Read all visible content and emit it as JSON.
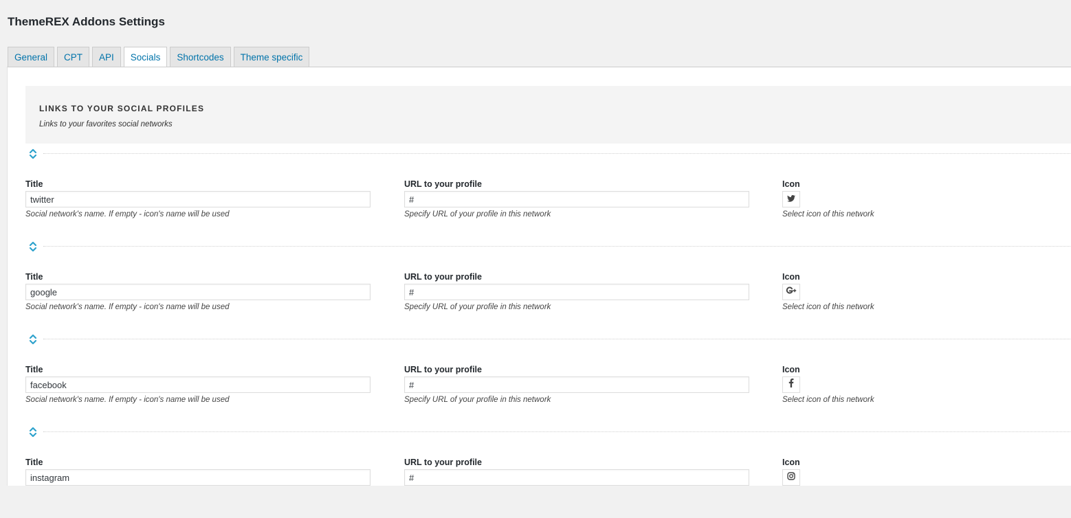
{
  "page": {
    "title": "ThemeREX Addons Settings"
  },
  "tabs": [
    {
      "label": "General",
      "active": false
    },
    {
      "label": "CPT",
      "active": false
    },
    {
      "label": "API",
      "active": false
    },
    {
      "label": "Socials",
      "active": true
    },
    {
      "label": "Shortcodes",
      "active": false
    },
    {
      "label": "Theme specific",
      "active": false
    }
  ],
  "section": {
    "title": "LINKS TO YOUR SOCIAL PROFILES",
    "subtitle": "Links to your favorites social networks"
  },
  "labels": {
    "title": "Title",
    "url": "URL to your profile",
    "icon": "Icon",
    "title_desc": "Social network's name. If empty - icon's name will be used",
    "url_desc": "Specify URL of your profile in this network",
    "icon_desc": "Select icon of this network"
  },
  "socials": [
    {
      "title": "twitter",
      "url": "#",
      "icon": "twitter-icon"
    },
    {
      "title": "google",
      "url": "#",
      "icon": "google-plus-icon"
    },
    {
      "title": "facebook",
      "url": "#",
      "icon": "facebook-icon"
    },
    {
      "title": "instagram",
      "url": "#",
      "icon": "instagram-icon"
    }
  ],
  "colors": {
    "accent": "#0073aa",
    "handle": "#2ea2cc",
    "section_bg": "#f4f4f4"
  }
}
